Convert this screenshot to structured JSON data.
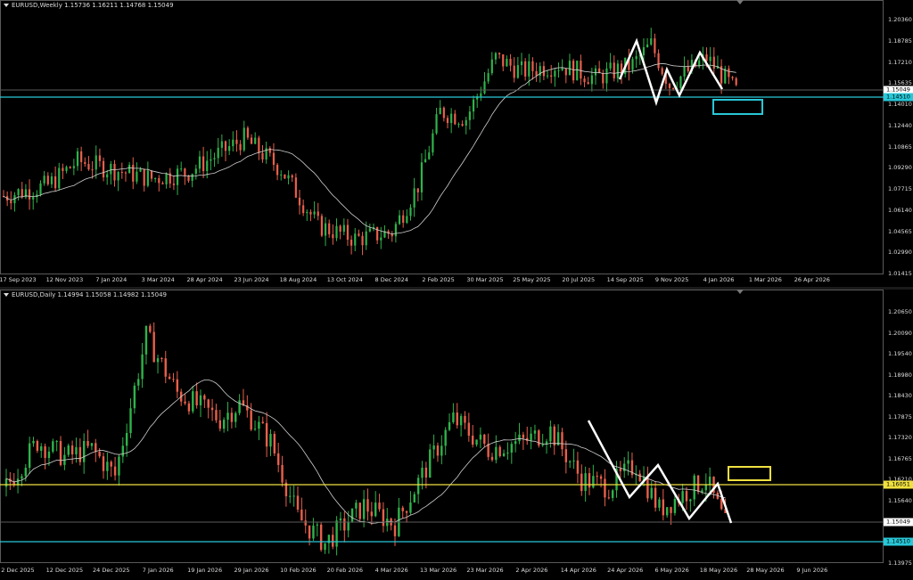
{
  "colors": {
    "bull": "#2fb34a",
    "bear": "#e8604c",
    "ma": "#cfcfcf",
    "cyan": "#28c8d8",
    "yellow": "#f0e040",
    "pattern": "#ffffff"
  },
  "weekly": {
    "header": "EURUSD,Weekly  1.15736 1.16211 1.14768 1.15049",
    "y_ticks": [
      "1.20360",
      "1.18785",
      "1.17210",
      "1.15635",
      "1.14010",
      "1.12440",
      "1.10865",
      "1.09290",
      "1.07715",
      "1.06140",
      "1.04565",
      "1.02990",
      "1.01415"
    ],
    "x_ticks": [
      "17 Sep 2023",
      "12 Nov 2023",
      "7 Jan 2024",
      "3 Mar 2024",
      "28 Apr 2024",
      "23 Jun 2024",
      "18 Aug 2024",
      "13 Oct 2024",
      "8 Dec 2024",
      "2 Feb 2025",
      "30 Mar 2025",
      "25 May 2025",
      "20 Jul 2025",
      "14 Sep 2025",
      "9 Nov 2025",
      "4 Jan 2026",
      "1 Mar 2026",
      "26 Apr 2026"
    ],
    "price_tag": "1.15049",
    "level_tag": "1.14510",
    "y_range": [
      1.01415,
      1.2036
    ]
  },
  "daily": {
    "header": "EURUSD,Daily  1.14994 1.15058 1.14982 1.15049",
    "y_ticks": [
      "1.20650",
      "1.20090",
      "1.19540",
      "1.18980",
      "1.18430",
      "1.17875",
      "1.17320",
      "1.16765",
      "1.16210",
      "1.15640",
      "1.15095",
      "1.14535",
      "1.13975"
    ],
    "x_ticks": [
      "2 Dec 2025",
      "12 Dec 2025",
      "24 Dec 2025",
      "7 Jan 2026",
      "19 Jan 2026",
      "29 Jan 2026",
      "10 Feb 2026",
      "20 Feb 2026",
      "4 Mar 2026",
      "13 Mar 2026",
      "23 Mar 2026",
      "2 Apr 2026",
      "14 Apr 2026",
      "24 Apr 2026",
      "6 May 2026",
      "18 May 2026",
      "28 May 2026",
      "9 Jun 2026"
    ],
    "price_tag": "1.15049",
    "resistance_tag": "1.16051",
    "support_tag": "1.14510",
    "y_range": [
      1.13975,
      1.2065
    ]
  }
}
